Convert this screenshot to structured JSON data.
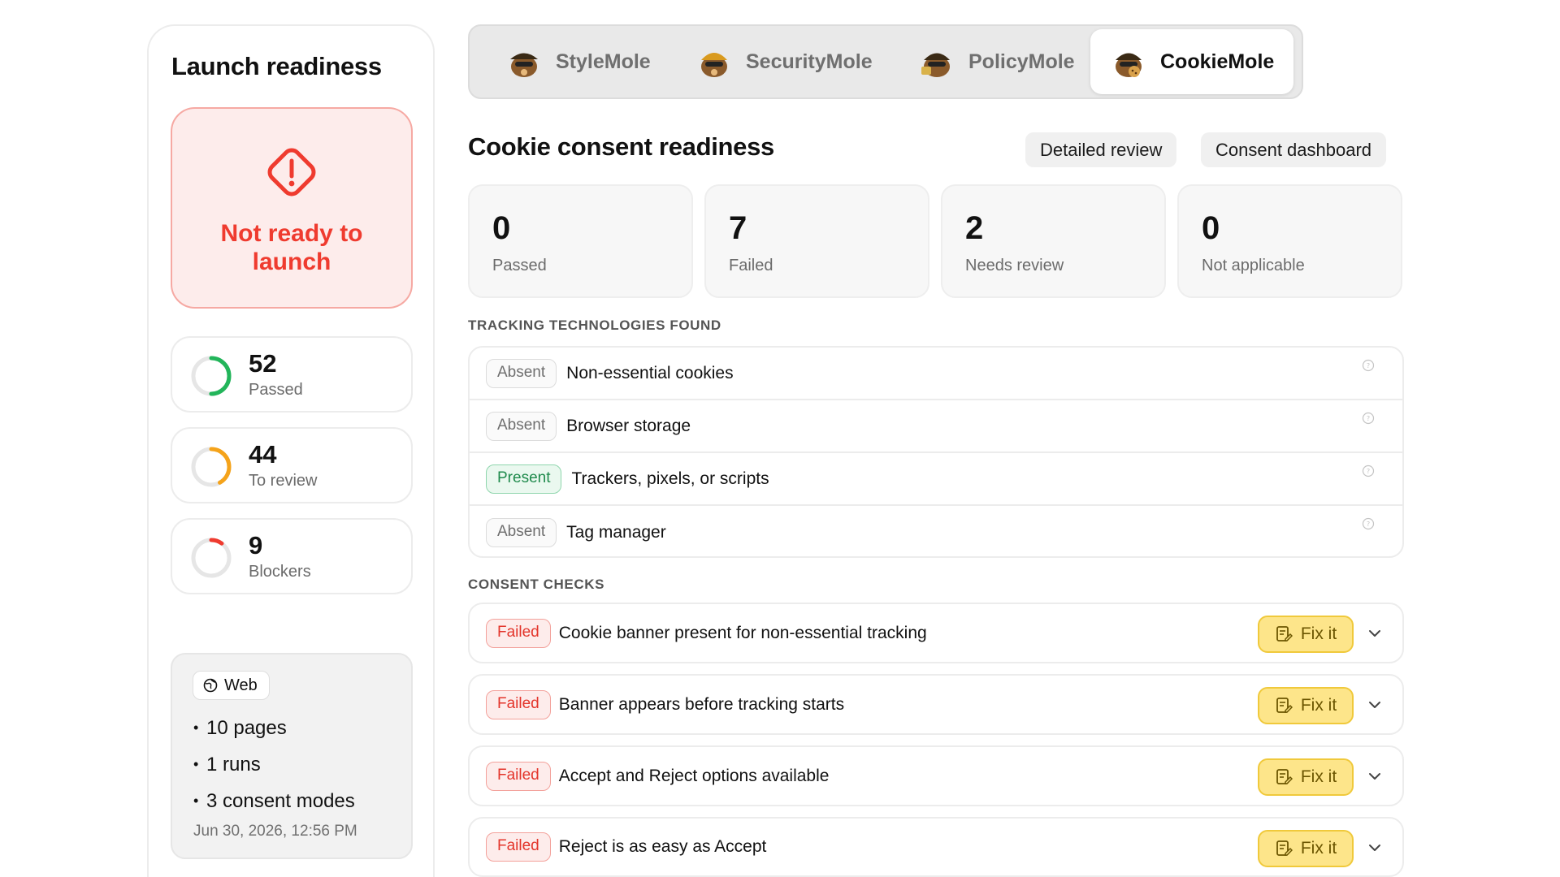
{
  "sidebar": {
    "title": "Launch readiness",
    "status": "Not ready to launch",
    "metrics": [
      {
        "value": "52",
        "label": "Passed",
        "color": "#22b55a",
        "fraction": 0.5
      },
      {
        "value": "44",
        "label": "To review",
        "color": "#f5a31a",
        "fraction": 0.42
      },
      {
        "value": "9",
        "label": "Blockers",
        "color": "#ef3b2f",
        "fraction": 0.1
      }
    ],
    "meta": {
      "platform": "Web",
      "items": [
        "10 pages",
        "1 runs",
        "3 consent modes"
      ],
      "date": "Jun 30, 2026, 12:56 PM"
    }
  },
  "tabs": [
    {
      "label": "StyleMole",
      "icon": "mole-icon",
      "active": false
    },
    {
      "label": "SecurityMole",
      "icon": "mole-icon",
      "active": false
    },
    {
      "label": "PolicyMole",
      "icon": "mole-icon",
      "active": false
    },
    {
      "label": "CookieMole",
      "icon": "mole-icon",
      "active": true
    }
  ],
  "main": {
    "title": "Cookie consent readiness",
    "buttons": {
      "detailed": "Detailed review",
      "dashboard": "Consent dashboard"
    },
    "stats": [
      {
        "value": "0",
        "label": "Passed"
      },
      {
        "value": "7",
        "label": "Failed"
      },
      {
        "value": "2",
        "label": "Needs review"
      },
      {
        "value": "0",
        "label": "Not applicable"
      }
    ],
    "tracking_label": "TRACKING TECHNOLOGIES FOUND",
    "tracking": [
      {
        "status": "Absent",
        "name": "Non-essential cookies"
      },
      {
        "status": "Absent",
        "name": "Browser storage"
      },
      {
        "status": "Present",
        "name": "Trackers, pixels, or scripts"
      },
      {
        "status": "Absent",
        "name": "Tag manager"
      }
    ],
    "checks_label": "CONSENT CHECKS",
    "checks": [
      {
        "status": "Failed",
        "name": "Cookie banner present for non-essential tracking",
        "action": "Fix it"
      },
      {
        "status": "Failed",
        "name": "Banner appears before tracking starts",
        "action": "Fix it"
      },
      {
        "status": "Failed",
        "name": "Accept and Reject options available",
        "action": "Fix it"
      },
      {
        "status": "Failed",
        "name": "Reject is as easy as Accept",
        "action": "Fix it"
      }
    ]
  },
  "colors": {
    "danger": "#ef3b2f",
    "success": "#22b55a",
    "warning": "#f5a31a",
    "fix": "#fde58a"
  }
}
